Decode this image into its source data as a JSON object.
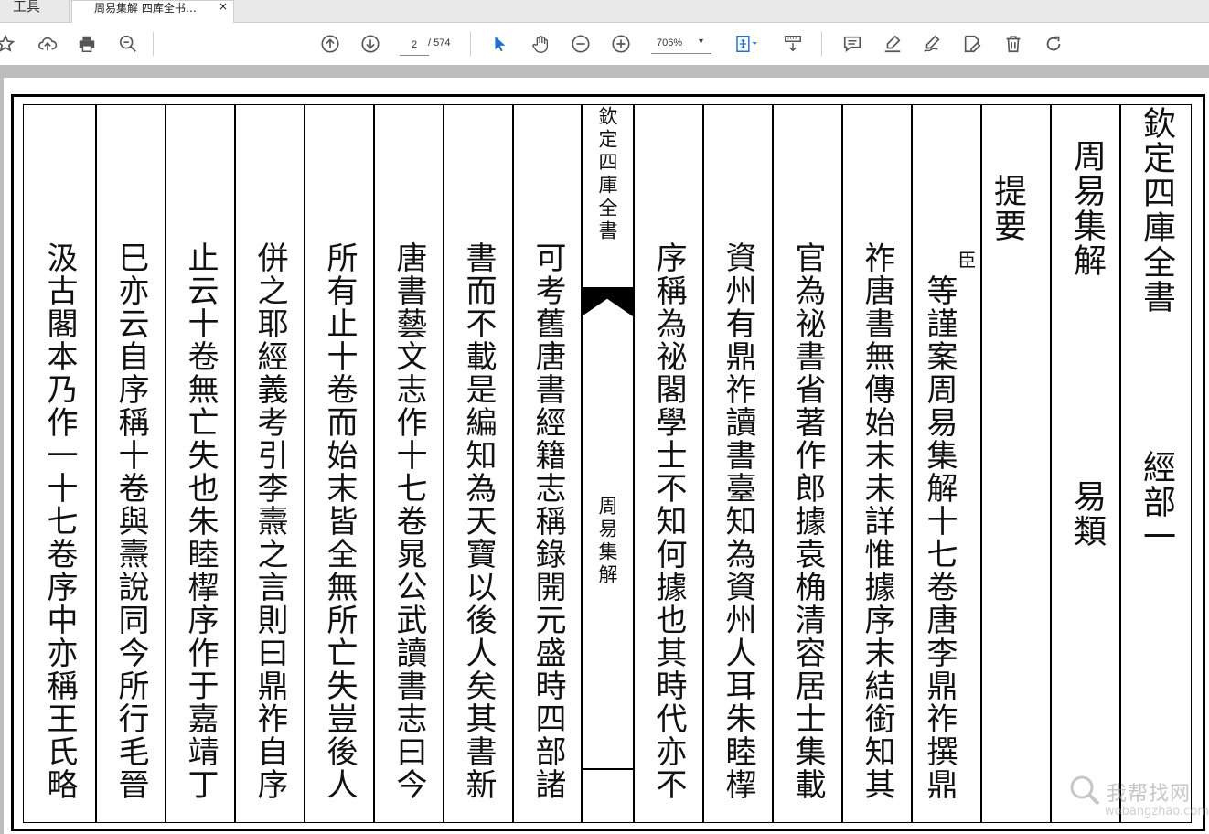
{
  "tabs": {
    "tools_label": "工具",
    "document_title": "周易集解 四库全书…",
    "close_glyph": "×"
  },
  "toolbar": {
    "page_current": "2",
    "page_total": "/ 574",
    "zoom": "706%",
    "icons": [
      "star-icon",
      "upload-icon",
      "print-icon",
      "zoom-search-icon",
      "page-up-icon",
      "page-down-icon",
      "select-pointer-icon",
      "hand-icon",
      "zoom-out-icon",
      "zoom-in-icon",
      "fit-page-icon",
      "scroll-mode-icon",
      "comment-icon",
      "highlight-icon",
      "sign-icon",
      "edit-icon",
      "delete-icon",
      "rotate-icon"
    ]
  },
  "document": {
    "columns": [
      {
        "id": "c1",
        "text": "欽定四庫全書",
        "sub": "經部一"
      },
      {
        "id": "c2",
        "text": "周易集解",
        "sub": "易類"
      },
      {
        "id": "c3",
        "text": "提要"
      },
      {
        "id": "c4",
        "note": "臣",
        "text": "等謹案周易集解十七卷唐李鼎祚撰鼎"
      },
      {
        "id": "c5",
        "text": "祚唐書無傳始末未詳惟據序末結銜知其"
      },
      {
        "id": "c6",
        "text": "官為祕書省著作郎據袁桷清容居士集載"
      },
      {
        "id": "c7",
        "text": "資州有鼎祚讀書臺知為資州人耳朱睦㮮"
      },
      {
        "id": "c8",
        "text": "序稱為祕閣學士不知何據也其時代亦不"
      },
      {
        "id": "fold",
        "header": "欽定四庫全書",
        "title": "周易集解"
      },
      {
        "id": "c9",
        "text": "可考舊唐書經籍志稱錄開元盛時四部諸"
      },
      {
        "id": "c10",
        "text": "書而不載是編知為天寶以後人矣其書新"
      },
      {
        "id": "c11",
        "text": "唐書藝文志作十七卷晁公武讀書志曰今"
      },
      {
        "id": "c12",
        "text": "所有止十卷而始末皆全無所亡失豈後人"
      },
      {
        "id": "c13",
        "text": "併之耶經義考引李燾之言則曰鼎祚自序"
      },
      {
        "id": "c14",
        "text": "止云十卷無亡失也朱睦㮮序作于嘉靖丁"
      },
      {
        "id": "c15",
        "text": "巳亦云自序稱十卷與燾說同今所行毛晉"
      },
      {
        "id": "c16",
        "text": "汲古閣本乃作一十七卷序中亦稱王氏略"
      }
    ]
  },
  "watermark": {
    "name": "我帮找网",
    "url": "wobangzhao.com"
  }
}
